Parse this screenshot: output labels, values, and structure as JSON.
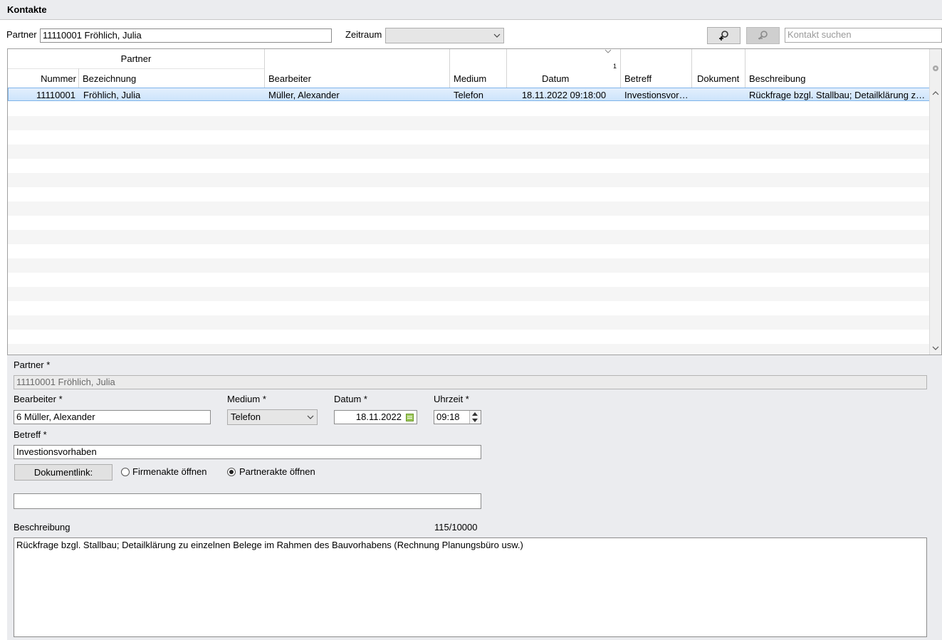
{
  "window": {
    "title": "Kontakte"
  },
  "toolbar": {
    "partner_label": "Partner",
    "partner_value": "11110001   Fröhlich, Julia",
    "zeitraum_label": "Zeitraum",
    "zeitraum_value": "",
    "search_placeholder": "Kontakt suchen"
  },
  "grid": {
    "group_header": "Partner",
    "sort_indicator": "1",
    "columns": [
      "Nummer",
      "Bezeichnung",
      "Bearbeiter",
      "Medium",
      "Datum",
      "Betreff",
      "Dokument",
      "Beschreibung"
    ],
    "rows": [
      {
        "nummer": "11110001",
        "bezeichnung": "Fröhlich, Julia",
        "bearbeiter": "Müller, Alexander",
        "medium": "Telefon",
        "datum": "18.11.2022 09:18:00",
        "betreff": "Investionsvorhaben",
        "dokument": "",
        "beschreibung": "Rückfrage bzgl. Stallbau; Detailklärung zu einzelnen Belege im Rahmen des Bauvorhabens (Rechnung Planungsbüro usw.)"
      }
    ]
  },
  "form": {
    "partner_label": "Partner *",
    "partner_value": "11110001   Fröhlich, Julia",
    "bearbeiter_label": "Bearbeiter *",
    "bearbeiter_value": "6   Müller, Alexander",
    "medium_label": "Medium *",
    "medium_value": "Telefon",
    "datum_label": "Datum *",
    "datum_value": "18.11.2022",
    "uhrzeit_label": "Uhrzeit *",
    "uhrzeit_value": "09:18",
    "betreff_label": "Betreff *",
    "betreff_value": "Investionsvorhaben",
    "dokumentlink_button": "Dokumentlink:",
    "radio_firmenakte": "Firmenakte öffnen",
    "radio_partnerakte": "Partnerakte öffnen",
    "selected_radio": "partnerakte",
    "dokumentlink_value": "",
    "beschreibung_label": "Beschreibung",
    "char_count": "115/10000",
    "beschreibung_value": "Rückfrage bzgl. Stallbau; Detailklärung zu einzelnen Belege im Rahmen des Bauvorhabens (Rechnung Planungsbüro usw.)"
  },
  "icons": {
    "add_search": "magnifier-plus-icon",
    "remove_search": "magnifier-minus-icon",
    "dropdown": "chevron-down-icon",
    "calendar": "calendar-icon",
    "spinner": "spinner-arrows-icon"
  }
}
